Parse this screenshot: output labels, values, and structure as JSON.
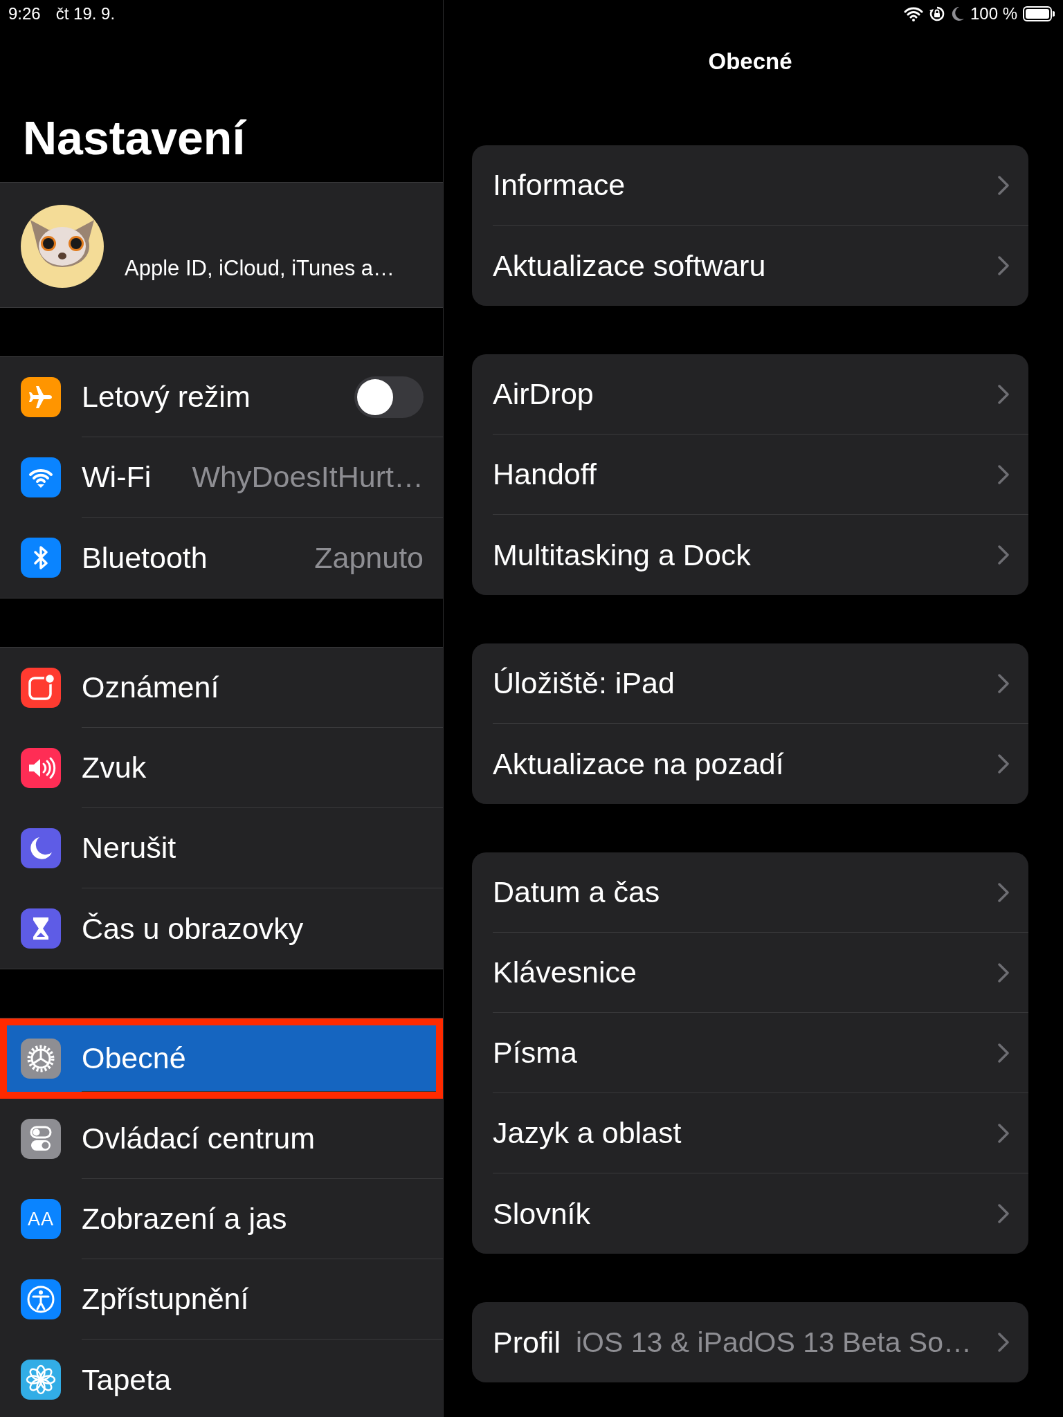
{
  "status_bar": {
    "time": "9:26",
    "date": "čt 19. 9.",
    "battery": "100 %"
  },
  "sidebar": {
    "title": "Nastavení",
    "account": {
      "subtitle": "Apple ID, iCloud, iTunes a…"
    },
    "groups": [
      {
        "items": [
          {
            "label": "Letový režim",
            "kind": "toggle",
            "on": false,
            "selected": false,
            "outlined": false
          },
          {
            "label": "Wi-Fi",
            "kind": "value",
            "value": "WhyDoesItHurt…",
            "selected": false,
            "outlined": false
          },
          {
            "label": "Bluetooth",
            "kind": "value",
            "value": "Zapnuto",
            "selected": false,
            "outlined": false
          }
        ]
      },
      {
        "items": [
          {
            "label": "Oznámení",
            "kind": "plain",
            "selected": false,
            "outlined": false
          },
          {
            "label": "Zvuk",
            "kind": "plain",
            "selected": false,
            "outlined": false
          },
          {
            "label": "Nerušit",
            "kind": "plain",
            "selected": false,
            "outlined": false
          },
          {
            "label": "Čas u obrazovky",
            "kind": "plain",
            "selected": false,
            "outlined": false
          }
        ]
      },
      {
        "items": [
          {
            "label": "Obecné",
            "kind": "plain",
            "selected": true,
            "outlined": true
          },
          {
            "label": "Ovládací centrum",
            "kind": "plain",
            "selected": false,
            "outlined": false
          },
          {
            "label": "Zobrazení a jas",
            "kind": "plain",
            "icon_text": "AA",
            "selected": false,
            "outlined": false
          },
          {
            "label": "Zpřístupnění",
            "kind": "plain",
            "selected": false,
            "outlined": false
          },
          {
            "label": "Tapeta",
            "kind": "plain",
            "selected": false,
            "outlined": false
          }
        ]
      }
    ]
  },
  "detail": {
    "title": "Obecné",
    "groups": [
      {
        "items": [
          {
            "label": "Informace"
          },
          {
            "label": "Aktualizace softwaru"
          }
        ]
      },
      {
        "items": [
          {
            "label": "AirDrop"
          },
          {
            "label": "Handoff"
          },
          {
            "label": "Multitasking a Dock"
          }
        ]
      },
      {
        "items": [
          {
            "label": "Úložiště: iPad"
          },
          {
            "label": "Aktualizace na pozadí"
          }
        ]
      },
      {
        "items": [
          {
            "label": "Datum a čas"
          },
          {
            "label": "Klávesnice"
          },
          {
            "label": "Písma"
          },
          {
            "label": "Jazyk a oblast"
          },
          {
            "label": "Slovník"
          }
        ]
      },
      {
        "items": [
          {
            "label": "Profil",
            "value": "iOS 13 & iPadOS 13 Beta So…"
          }
        ]
      }
    ]
  }
}
